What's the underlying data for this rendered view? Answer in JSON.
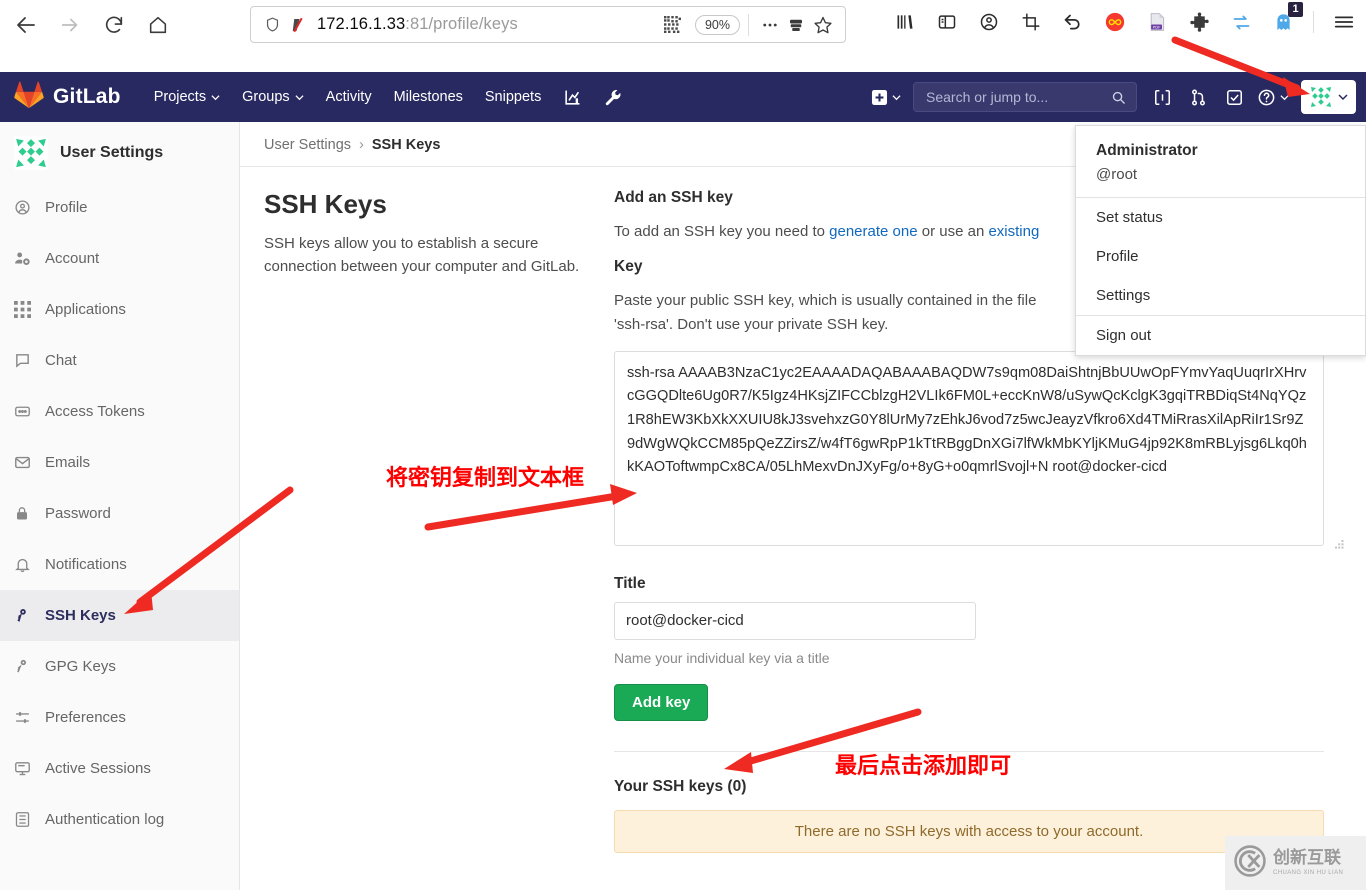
{
  "browser": {
    "back_icon": "back-arrow-icon",
    "forward_icon": "forward-arrow-icon",
    "reload_icon": "reload-icon",
    "home_icon": "home-icon",
    "shield_icon": "shield-icon",
    "protection_icon": "tracking-protection-off-icon",
    "url_host": "172.16.1.33",
    "url_path": ":81/profile/keys",
    "qr_icon": "qr-code-icon",
    "zoom_level": "90%",
    "more_icon": "ellipsis-icon",
    "reader_icon": "save-to-device-icon",
    "bookmark_icon": "star-icon",
    "right_icons": [
      {
        "name": "library-icon",
        "label": "Library"
      },
      {
        "name": "sidebar-icon",
        "label": "Sidebars"
      },
      {
        "name": "account-icon",
        "label": "Account"
      },
      {
        "name": "screenshot-icon",
        "label": "Screenshot"
      },
      {
        "name": "undo-icon",
        "label": "Undo close tab"
      },
      {
        "name": "infinity-icon",
        "label": "Extension"
      },
      {
        "name": "pdf-icon",
        "label": "PDF tool"
      },
      {
        "name": "puzzle-icon",
        "label": "Extensions"
      },
      {
        "name": "sync-icon",
        "label": "Sync"
      },
      {
        "name": "ghost-icon",
        "label": "Ghost extension",
        "badge": "1"
      }
    ],
    "menu_icon": "hamburger-menu-icon"
  },
  "navbar": {
    "brand": "GitLab",
    "brand_icon": "gitlab-tanuki-icon",
    "menu": [
      {
        "label": "Projects",
        "caret": true,
        "name": "nav-projects"
      },
      {
        "label": "Groups",
        "caret": true,
        "name": "nav-groups"
      },
      {
        "label": "Activity",
        "caret": false,
        "name": "nav-activity"
      },
      {
        "label": "Milestones",
        "caret": false,
        "name": "nav-milestones"
      },
      {
        "label": "Snippets",
        "caret": false,
        "name": "nav-snippets"
      }
    ],
    "analytics_icon": "analytics-chart-icon",
    "admin_icon": "wrench-icon",
    "create_icon": "plus-square-icon",
    "search_placeholder": "Search or jump to...",
    "search_value": "",
    "search_icon": "magnifier-icon",
    "issues_icon": "issues-icon",
    "merge_requests_icon": "merge-request-icon",
    "todos_icon": "todos-check-icon",
    "help_icon": "question-circle-icon",
    "user_avatar_icon": "user-identicon-avatar",
    "user_caret_icon": "chevron-down-icon"
  },
  "user_dropdown": {
    "name": "Administrator",
    "handle": "@root",
    "items": [
      {
        "label": "Set status",
        "name": "dropdown-set-status"
      },
      {
        "label": "Profile",
        "name": "dropdown-profile"
      },
      {
        "label": "Settings",
        "name": "dropdown-settings"
      }
    ],
    "sign_out": "Sign out"
  },
  "sidebar": {
    "title": "User Settings",
    "avatar_icon": "user-identicon-avatar",
    "items": [
      {
        "label": "Profile",
        "icon": "user-circle-icon",
        "active": false
      },
      {
        "label": "Account",
        "icon": "account-gear-icon",
        "active": false
      },
      {
        "label": "Applications",
        "icon": "grid-apps-icon",
        "active": false
      },
      {
        "label": "Chat",
        "icon": "chat-bubble-icon",
        "active": false
      },
      {
        "label": "Access Tokens",
        "icon": "token-icon",
        "active": false
      },
      {
        "label": "Emails",
        "icon": "envelope-icon",
        "active": false
      },
      {
        "label": "Password",
        "icon": "lock-icon",
        "active": false
      },
      {
        "label": "Notifications",
        "icon": "bell-icon",
        "active": false
      },
      {
        "label": "SSH Keys",
        "icon": "key-icon",
        "active": true
      },
      {
        "label": "GPG Keys",
        "icon": "key-icon",
        "active": false
      },
      {
        "label": "Preferences",
        "icon": "sliders-icon",
        "active": false
      },
      {
        "label": "Active Sessions",
        "icon": "monitor-icon",
        "active": false
      },
      {
        "label": "Authentication log",
        "icon": "log-list-icon",
        "active": false
      }
    ]
  },
  "breadcrumb": {
    "parent": "User Settings",
    "separator": "›",
    "current": "SSH Keys"
  },
  "page": {
    "title": "SSH Keys",
    "description": "SSH keys allow you to establish a secure connection between your computer and GitLab."
  },
  "form": {
    "section_title": "Add an SSH key",
    "intro_prefix": "To add an SSH key you need to ",
    "intro_link1": "generate one",
    "intro_mid": " or use an ",
    "intro_link2": "existing",
    "key_label": "Key",
    "key_help_line1": "Paste your public SSH key, which is usually contained in the file",
    "key_help_line2": "'ssh-rsa'. Don't use your private SSH key.",
    "key_value": "ssh-rsa AAAAB3NzaC1yc2EAAAADAQABAAABAQDW7s9qm08DaiShtnjBbUUwOpFYmvYaqUuqrIrXHrvcGGQDlte6Ug0R7/K5Igz4HKsjZIFCCblzgH2VLIk6FM0L+eccKnW8/uSywQcKclgK3gqiTRBDiqSt4NqYQz1R8hEW3KbXkXXUIU8kJ3svehxzG0Y8lUrMy7zEhkJ6vod7z5wcJeayzVfkro6Xd4TMiRrasXilApRiIr1Sr9Z9dWgWQkCCM85pQeZZirsZ/w4fT6gwRpP1kTtRBggDnXGi7lfWkMbKYljKMuG4jp92K8mRBLyjsg6Lkq0hkKAOToftwmpCx8CA/05LhMexvDnJXyFg/o+8yG+o0qmrlSvojl+N root@docker-cicd",
    "title_label": "Title",
    "title_value": "root@docker-cicd",
    "title_help": "Name your individual key via a title",
    "submit_label": "Add key",
    "your_keys_title": "Your SSH keys (0)",
    "no_keys_message": "There are no SSH keys with access to your account."
  },
  "annotations": [
    {
      "text": "将密钥复制到文本框",
      "name": "annotation-copy-key-to-textbox"
    },
    {
      "text": "最后点击添加即可",
      "name": "annotation-click-add"
    }
  ],
  "watermark": {
    "brand_cn": "创新互联",
    "brand_py": "CHUANG XIN HU LIAN",
    "logo_icon": "cx-logo-icon"
  },
  "colors": {
    "gitlab_navy": "#292961",
    "accent_green": "#1aaa55",
    "link_blue": "#1068bf",
    "annotation_red": "#ff0000",
    "alert_bg": "#fdf1dc"
  }
}
